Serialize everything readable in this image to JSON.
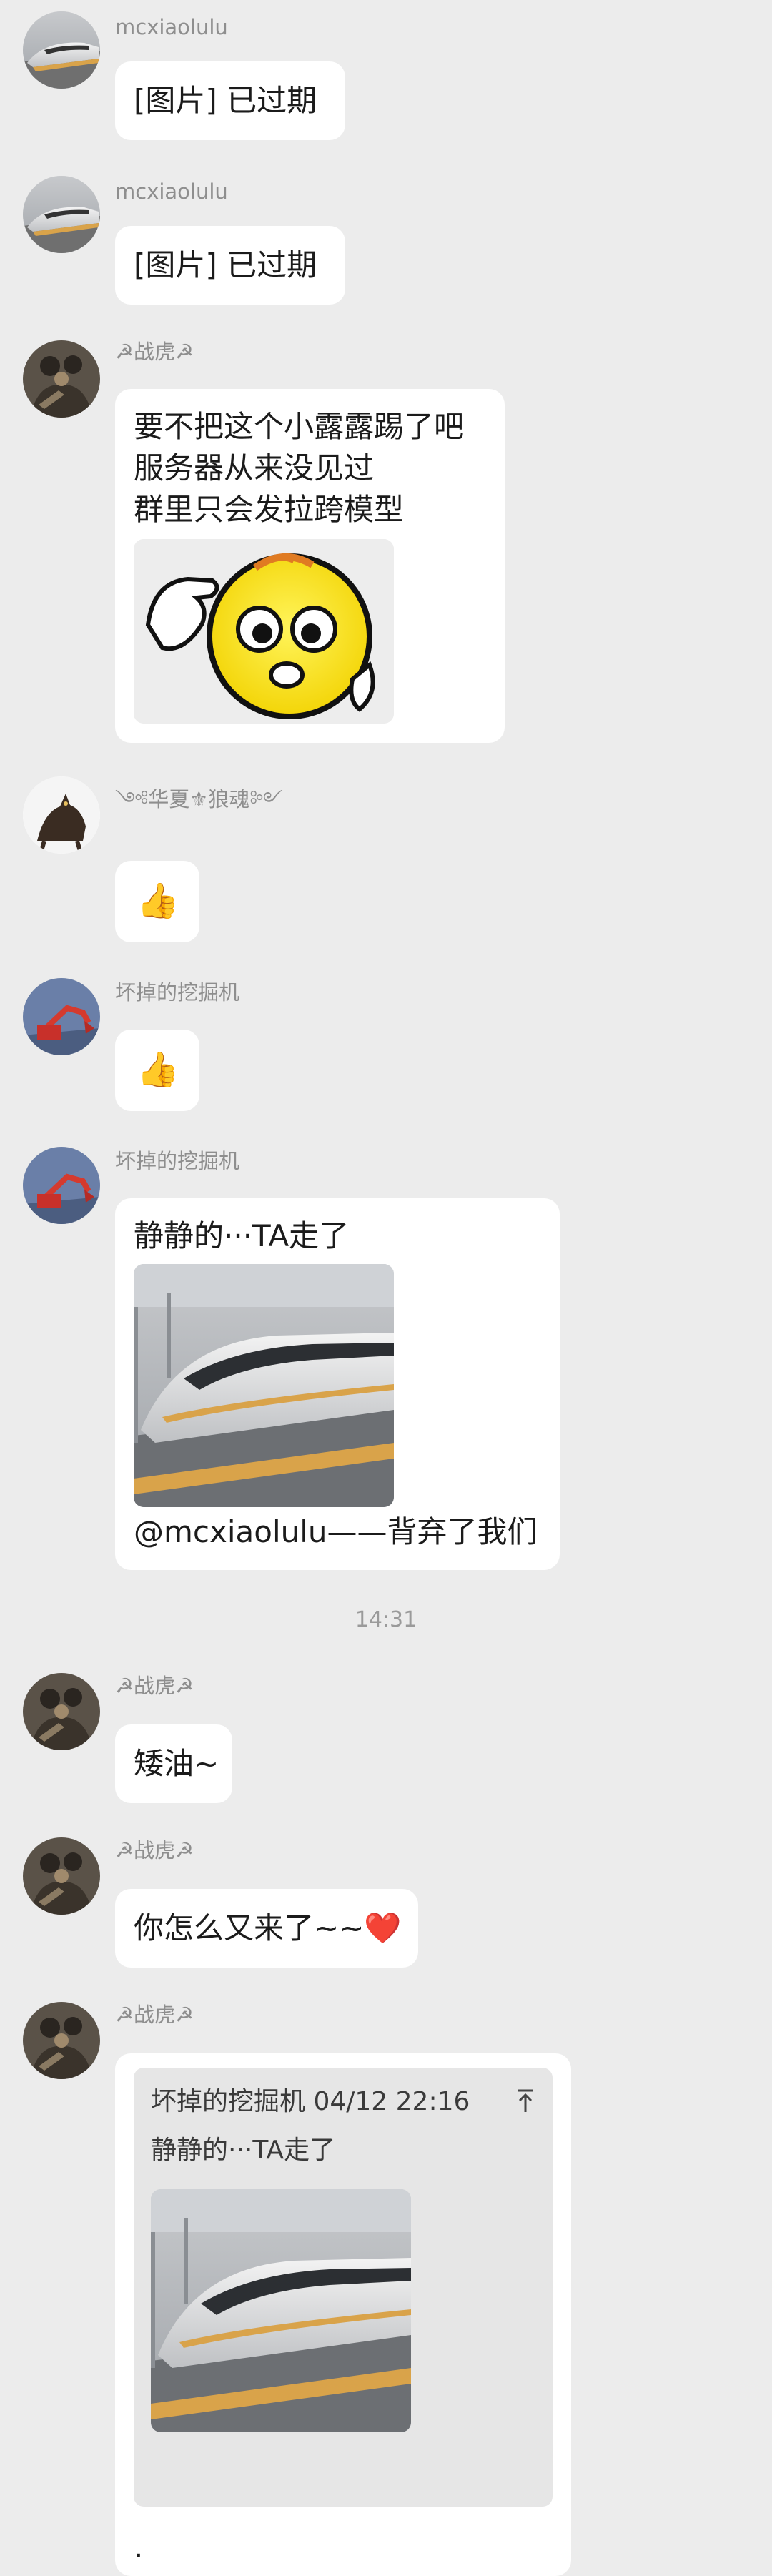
{
  "messages": [
    {
      "sender": "mcxiaolulu",
      "text": "[图片] 已过期"
    },
    {
      "sender": "mcxiaolulu",
      "text": "[图片] 已过期"
    },
    {
      "sender": "☭战虎☭",
      "lines": [
        "要不把这个小露露踢了吧",
        "服务器从来没见过",
        "群里只会发拉跨模型"
      ],
      "sticker": "sticker-image"
    },
    {
      "sender": "༺华夏⚜狼魂༻",
      "emoji": "👍"
    },
    {
      "sender": "坏掉的挖掘机",
      "emoji": "👍"
    },
    {
      "sender": "坏掉的挖掘机",
      "text_top": "静静的···TA走了",
      "text_bottom": "@mcxiaolulu——背弃了我们"
    },
    {
      "sender": "☭战虎☭",
      "text": "矮油~"
    },
    {
      "sender": "☭战虎☭",
      "text": "你怎么又来了~~❤️"
    },
    {
      "sender": "☭战虎☭",
      "quote": {
        "author_time": "坏掉的挖掘机 04/12 22:16",
        "text": "静静的···TA走了"
      },
      "trailing": "."
    }
  ],
  "timestamp": "14:31",
  "icons": {
    "quote_pin": "pin-icon",
    "thumbs_up": "thumbs-up-icon",
    "heart": "heart-icon"
  },
  "colors": {
    "background": "#ececec",
    "bubble": "#ffffff",
    "name": "#8e8e8e",
    "text": "#1b1b1b",
    "quote_card": "#e6e6e6"
  }
}
